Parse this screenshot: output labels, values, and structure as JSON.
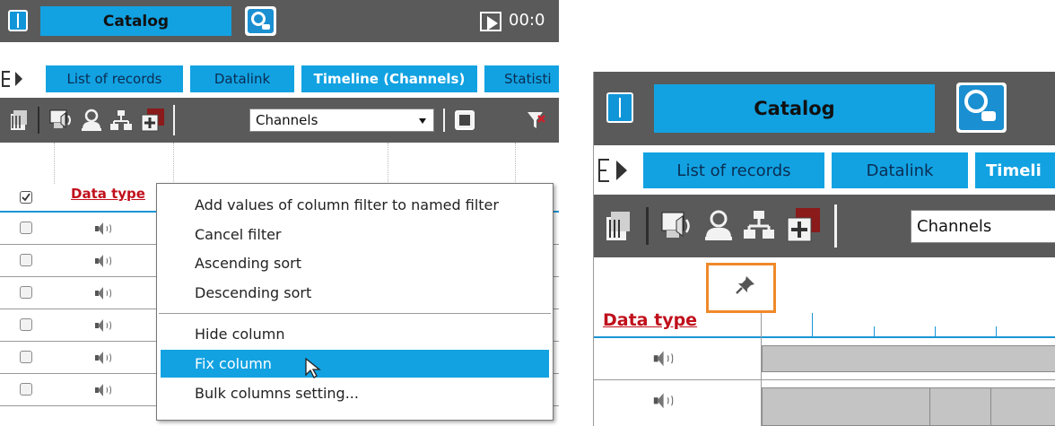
{
  "titlebar": {
    "catalog_label": "Catalog",
    "time": "00:0"
  },
  "tabs": {
    "left": [
      "List of records",
      "Datalink",
      "Timeline (Channels)",
      "Statisti"
    ],
    "right": [
      "List of records",
      "Datalink",
      "Timeli"
    ]
  },
  "toolbar": {
    "channels_select": "Channels",
    "icons": [
      "archive-icon",
      "monitor-speaker-icon",
      "user-icon",
      "tree-icon",
      "add-window-icon"
    ]
  },
  "grid": {
    "column_header": "Data type",
    "row_icon": "speaker-icon",
    "left_rows": 6,
    "right_rows": 2
  },
  "context_menu": {
    "items": [
      "Add values of column filter to named filter",
      "Cancel filter",
      "Ascending sort",
      "Descending sort",
      "Hide column",
      "Fix column",
      "Bulk columns setting..."
    ],
    "highlighted": "Fix column"
  },
  "colors": {
    "accent": "#12a2e2",
    "header_dark": "#5a5a5a",
    "datatype_red": "#c0101c",
    "highlight_box": "#f0892a"
  }
}
